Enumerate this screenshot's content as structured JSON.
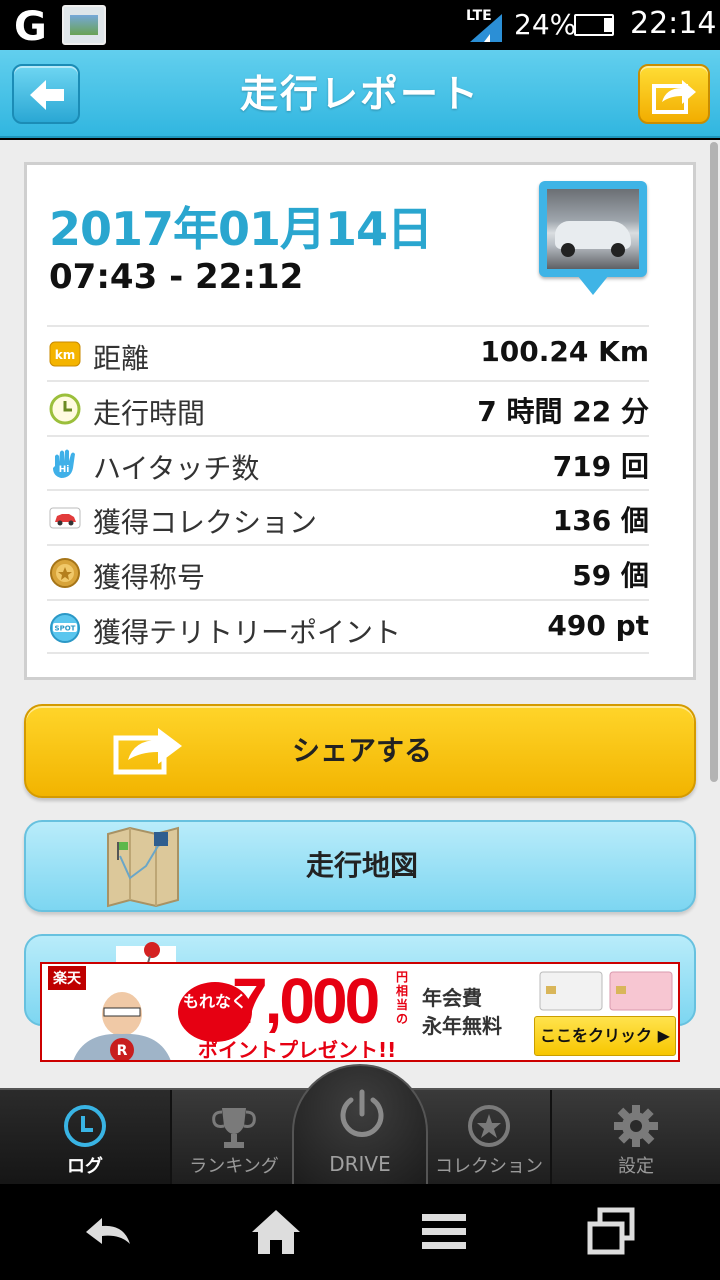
{
  "status_bar": {
    "network": "LTE",
    "battery_percent": "24%",
    "time": "22:14"
  },
  "header": {
    "title": "走行レポート"
  },
  "report": {
    "date": "2017年01月14日",
    "time_range": "07:43 - 22:12",
    "stats": [
      {
        "icon": "km-icon",
        "label": "距離",
        "value": "100.24 Km"
      },
      {
        "icon": "clock-icon",
        "label": "走行時間",
        "value": "7 時間 22 分"
      },
      {
        "icon": "hi-hand-icon",
        "label": "ハイタッチ数",
        "value": "719 回"
      },
      {
        "icon": "car-icon",
        "label": "獲得コレクション",
        "value": "136 個"
      },
      {
        "icon": "medal-icon",
        "label": "獲得称号",
        "value": "59 個"
      },
      {
        "icon": "spot-icon",
        "label": "獲得テリトリーポイント",
        "value": "490 pt"
      }
    ]
  },
  "actions": {
    "share_label": "シェアする",
    "map_label": "走行地図"
  },
  "ad": {
    "logo": "楽天",
    "bubble": "もれなく",
    "amount": "7,000",
    "unit": "円相当の",
    "present": "ポイントプレゼント!!",
    "fee_line1": "年会費",
    "fee_line2": "永年無料",
    "cta": "ここをクリック ▶"
  },
  "tabs": [
    {
      "label": "ログ",
      "icon": "log-clock-icon",
      "active": true
    },
    {
      "label": "ランキング",
      "icon": "trophy-icon",
      "active": false
    },
    {
      "label": "DRIVE",
      "icon": "power-icon",
      "active": false
    },
    {
      "label": "コレクション",
      "icon": "star-icon",
      "active": false
    },
    {
      "label": "設定",
      "icon": "gear-icon",
      "active": false
    }
  ],
  "colors": {
    "accent": "#31b6e0",
    "date": "#2aa6cf",
    "share": "#f2b400"
  }
}
